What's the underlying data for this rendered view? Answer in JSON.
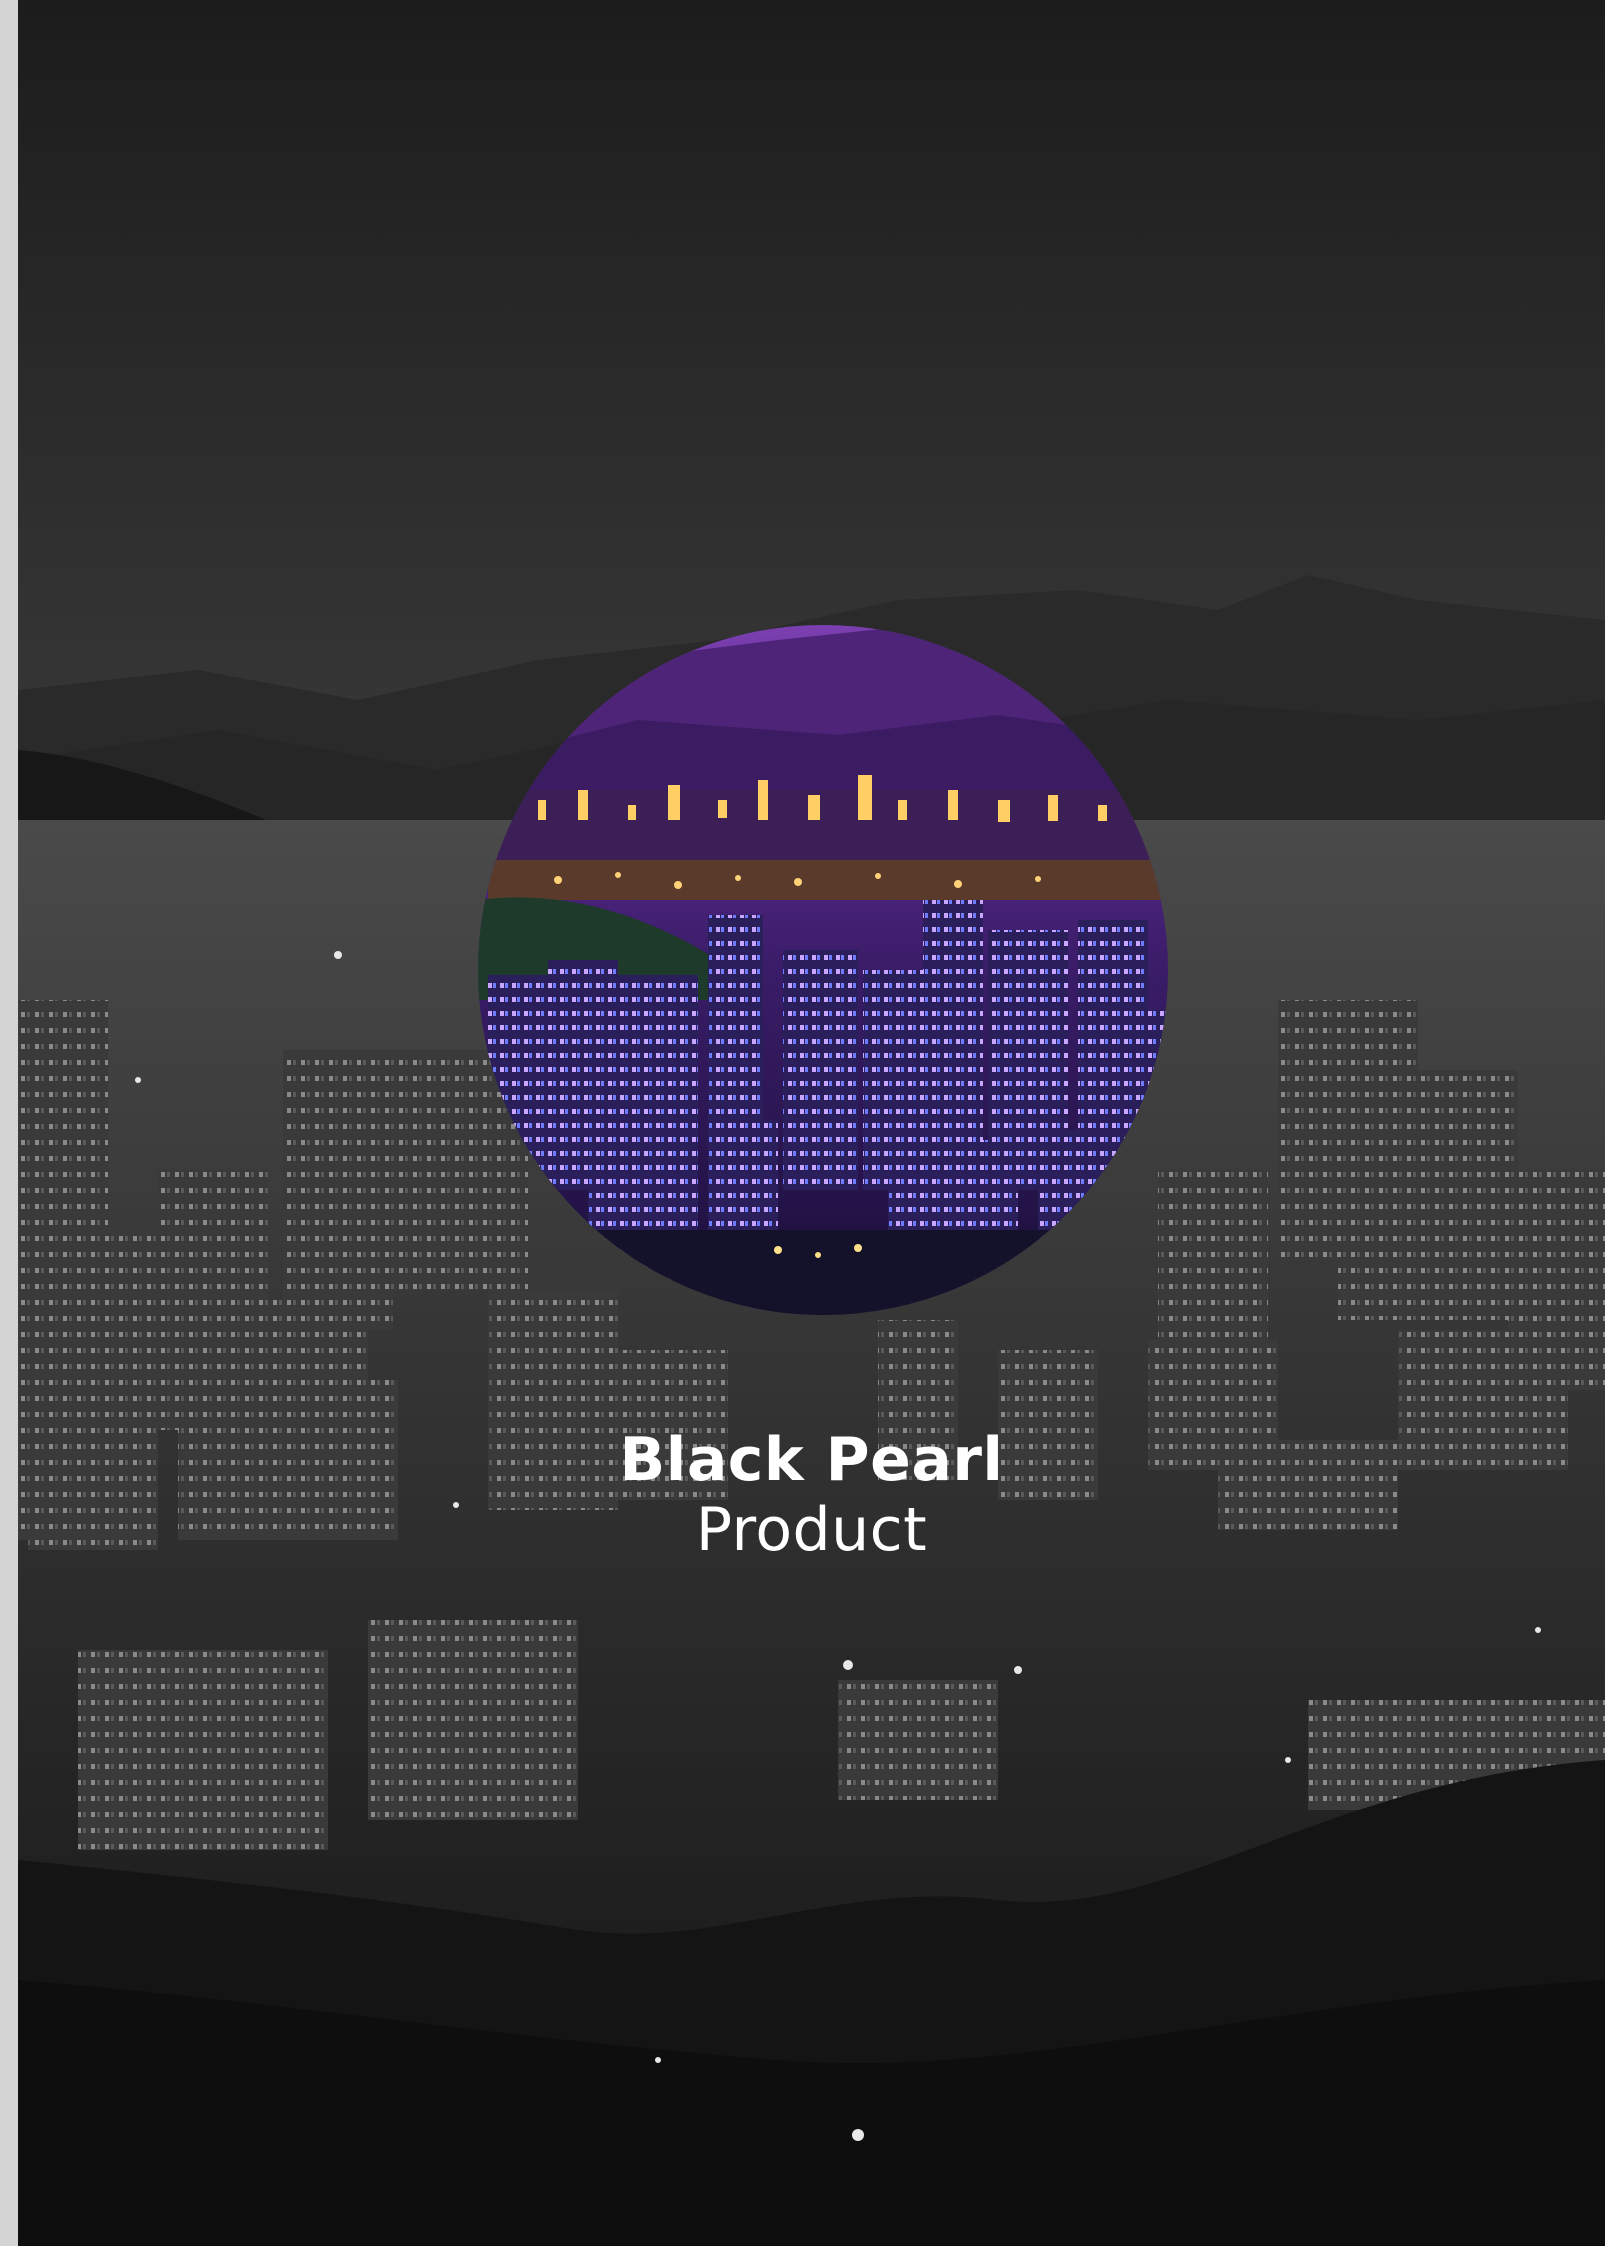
{
  "cover": {
    "title": "Black Pearl",
    "subtitle": "Product"
  },
  "colors": {
    "sky_top": "#1c1c1c",
    "sky_bottom": "#3a3a3a",
    "circle_sky": "#6a2fa0",
    "city_light": "#ffd27a",
    "page_edge": "#d4d4d4"
  }
}
